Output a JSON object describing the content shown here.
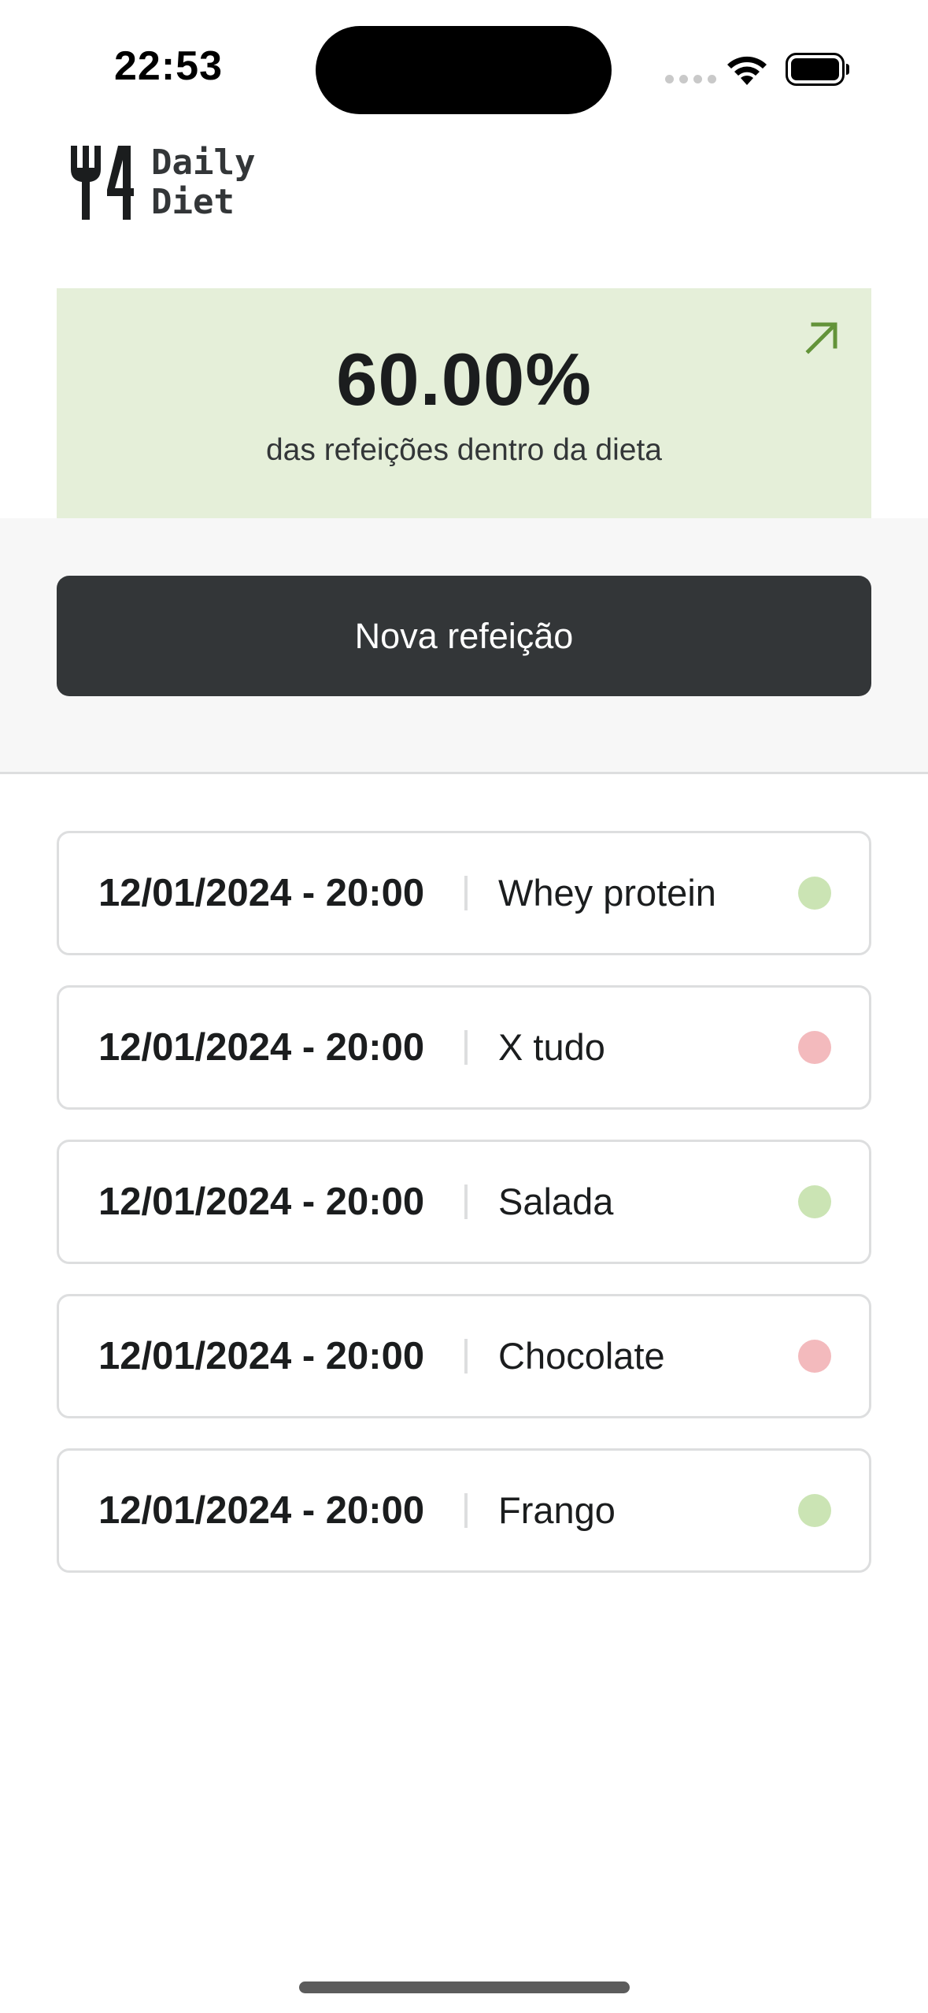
{
  "status_bar": {
    "time": "22:53",
    "icons": [
      "signal-dots-icon",
      "wifi-icon",
      "battery-icon"
    ]
  },
  "header": {
    "logo_line1": "Daily",
    "logo_line2": "Diet",
    "logo_icon": "fork-knife-icon"
  },
  "stats": {
    "percent": "60.00%",
    "caption": "das refeições dentro da dieta",
    "arrow_icon": "arrow-up-right-icon",
    "accent_color": "#639339",
    "background_color": "#e5efd9"
  },
  "actions": {
    "new_meal_label": "Nova refeição"
  },
  "meals": [
    {
      "datetime": "12/01/2024 - 20:00",
      "name": "Whey protein",
      "status": "in_diet",
      "status_color": "#cbe4b4"
    },
    {
      "datetime": "12/01/2024 - 20:00",
      "name": "X tudo",
      "status": "off_diet",
      "status_color": "#f3babd"
    },
    {
      "datetime": "12/01/2024 - 20:00",
      "name": "Salada",
      "status": "in_diet",
      "status_color": "#cbe4b4"
    },
    {
      "datetime": "12/01/2024 - 20:00",
      "name": "Chocolate",
      "status": "off_diet",
      "status_color": "#f3babd"
    },
    {
      "datetime": "12/01/2024 - 20:00",
      "name": "Frango",
      "status": "in_diet",
      "status_color": "#cbe4b4"
    }
  ]
}
